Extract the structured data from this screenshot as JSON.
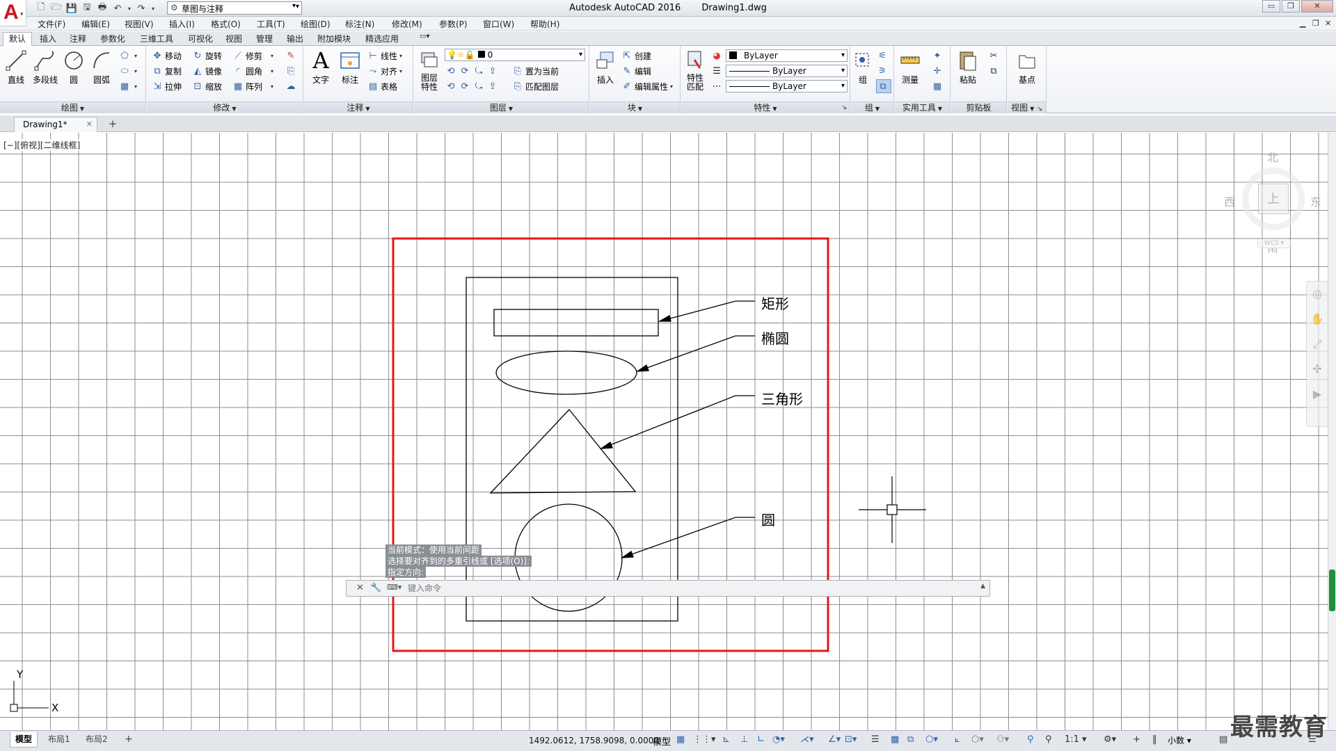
{
  "app": {
    "title": "Autodesk AutoCAD 2016",
    "file": "Drawing1.dwg",
    "workspace": "草图与注释"
  },
  "menu": [
    "文件(F)",
    "编辑(E)",
    "视图(V)",
    "插入(I)",
    "格式(O)",
    "工具(T)",
    "绘图(D)",
    "标注(N)",
    "修改(M)",
    "参数(P)",
    "窗口(W)",
    "帮助(H)"
  ],
  "ribbon_tabs": [
    "默认",
    "插入",
    "注释",
    "参数化",
    "三维工具",
    "可视化",
    "视图",
    "管理",
    "输出",
    "附加模块",
    "精选应用"
  ],
  "ribbon": {
    "draw": {
      "title": "绘图",
      "line": "直线",
      "polyline": "多段线",
      "circle": "圆",
      "arc": "圆弧"
    },
    "modify": {
      "title": "修改",
      "move": "移动",
      "rotate": "旋转",
      "trim": "修剪",
      "copy": "复制",
      "mirror": "镜像",
      "fillet": "圆角",
      "stretch": "拉伸",
      "scale": "缩放",
      "array": "阵列"
    },
    "annotation": {
      "title": "注释",
      "text": "文字",
      "dimension": "标注",
      "linear": "线性",
      "aligned": "对齐",
      "table": "表格"
    },
    "layers": {
      "title": "图层",
      "properties": "图层\n特性",
      "current_layer": "0",
      "set_current": "置为当前",
      "match": "匹配图层"
    },
    "block": {
      "title": "块",
      "insert": "插入",
      "create": "创建",
      "edit": "编辑",
      "edit_attr": "编辑属性"
    },
    "properties": {
      "title": "特性",
      "match": "特性\n匹配",
      "color": "ByLayer",
      "linetype": "ByLayer",
      "lineweight": "ByLayer"
    },
    "groups": {
      "title": "组",
      "group": "组"
    },
    "utilities": {
      "title": "实用工具",
      "measure": "测量"
    },
    "clipboard": {
      "title": "剪贴板",
      "paste": "粘贴"
    },
    "view": {
      "title": "视图",
      "base": "基点"
    }
  },
  "doc_tab": "Drawing1*",
  "viewport_label": "[−][俯视][二维线框]",
  "drawing_labels": {
    "rect": "矩形",
    "ellipse": "椭圆",
    "triangle": "三角形",
    "circle": "圆"
  },
  "viewcube": {
    "north": "北",
    "south": "南",
    "east": "东",
    "west": "西",
    "top": "上",
    "wcs": "WCS"
  },
  "ucs": {
    "x": "X",
    "y": "Y"
  },
  "command": {
    "history": [
      "当前模式：使用当前间距",
      "选择要对齐到的多重引线或 [选项(O)]:",
      "指定方向:"
    ],
    "placeholder": "键入命令"
  },
  "status": {
    "layouts": [
      "模型",
      "布局1",
      "布局2"
    ],
    "coords": "1492.0612, 1758.9098, 0.0000",
    "model": "模型",
    "scale": "1:1",
    "units": "小数"
  },
  "watermark": "最需教育",
  "colors": {
    "highlight_frame": "#e8161b",
    "grid": "#8d8d8d",
    "accent": "#2e63ad"
  }
}
